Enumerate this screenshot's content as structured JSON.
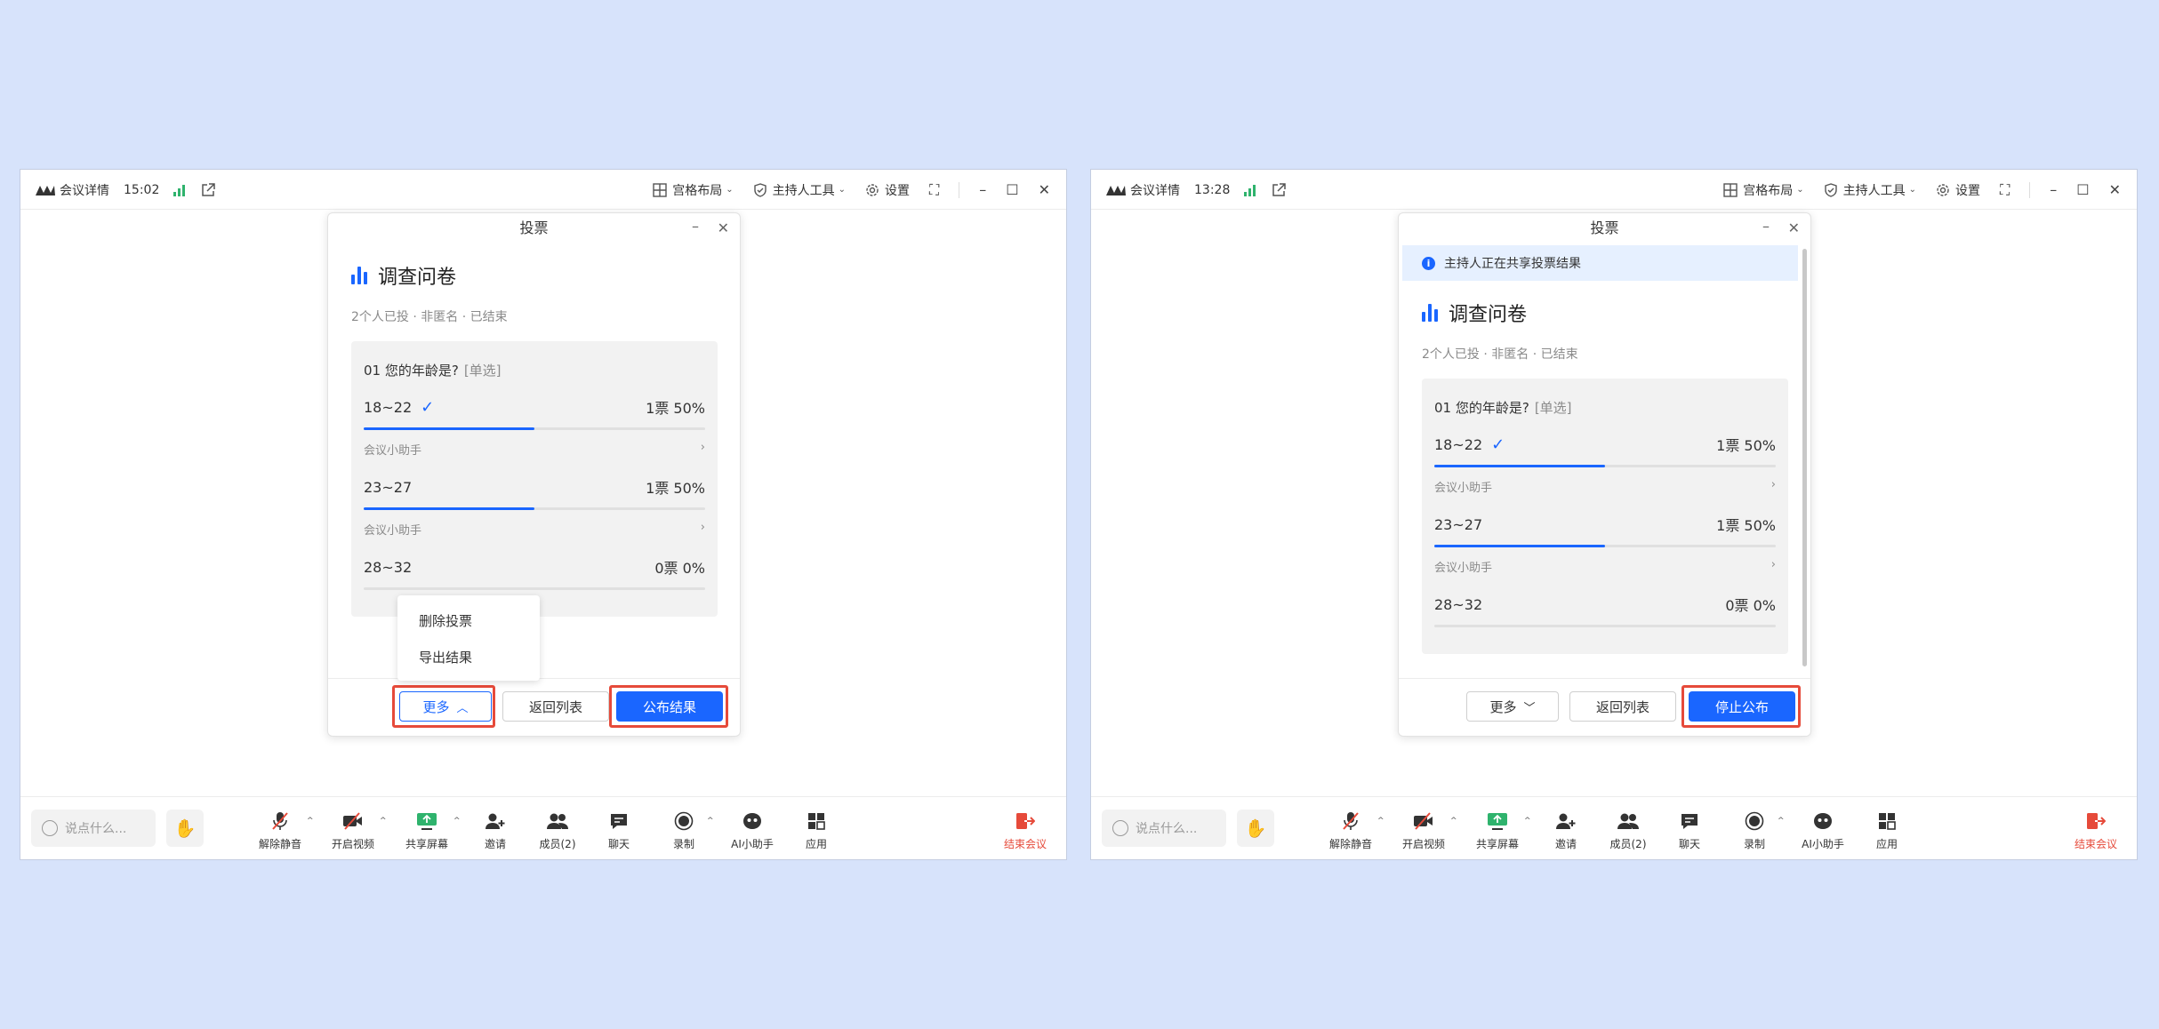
{
  "windows": [
    {
      "titlebar": {
        "title": "会议详情",
        "time": "15:02",
        "layout": "宫格布局",
        "host_tools": "主持人工具",
        "settings": "设置"
      },
      "dialog": {
        "header": "投票",
        "notice": "",
        "survey_title": "调查问卷",
        "meta": "2个人已投 · 非匿名 · 已结束",
        "question": "01  您的年龄是?",
        "question_tag": "[单选]",
        "options": [
          {
            "label": "18~22",
            "result": "1票 50%",
            "voted": true,
            "percent": 50,
            "voter": "会议小助手"
          },
          {
            "label": "23~27",
            "result": "1票 50%",
            "voted": false,
            "percent": 50,
            "voter": "会议小助手"
          },
          {
            "label": "28~32",
            "result": "0票 0%",
            "voted": false,
            "percent": 0,
            "voter": ""
          }
        ],
        "menu": [
          "删除投票",
          "导出结果"
        ],
        "more": "更多",
        "more_arrow": "up",
        "back": "返回列表",
        "primary": "公布结果"
      }
    },
    {
      "titlebar": {
        "title": "会议详情",
        "time": "13:28",
        "layout": "宫格布局",
        "host_tools": "主持人工具",
        "settings": "设置"
      },
      "dialog": {
        "header": "投票",
        "notice": "主持人正在共享投票结果",
        "survey_title": "调查问卷",
        "meta": "2个人已投 · 非匿名 · 已结束",
        "question": "01  您的年龄是?",
        "question_tag": "[单选]",
        "options": [
          {
            "label": "18~22",
            "result": "1票 50%",
            "voted": true,
            "percent": 50,
            "voter": "会议小助手"
          },
          {
            "label": "23~27",
            "result": "1票 50%",
            "voted": false,
            "percent": 50,
            "voter": "会议小助手"
          },
          {
            "label": "28~32",
            "result": "0票 0%",
            "voted": false,
            "percent": 0,
            "voter": ""
          }
        ],
        "menu": [],
        "more": "更多",
        "more_arrow": "down",
        "back": "返回列表",
        "primary": "停止公布"
      }
    }
  ],
  "toolbar": {
    "say_placeholder": "说点什么...",
    "unmute": "解除静音",
    "video": "开启视频",
    "share": "共享屏幕",
    "invite": "邀请",
    "members": "成员(2)",
    "chat": "聊天",
    "record": "录制",
    "ai": "AI小助手",
    "apps": "应用",
    "end": "结束会议"
  },
  "colors": {
    "accent": "#1a66ff",
    "highlight": "#e64a3a",
    "signal": "#2fb36d",
    "background": "#d7e3fb"
  }
}
